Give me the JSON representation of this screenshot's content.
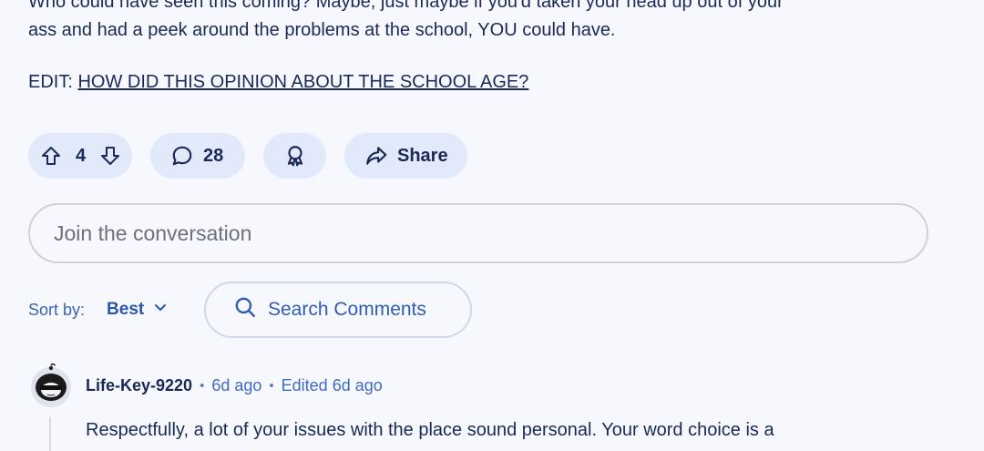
{
  "post": {
    "body_line1": "Who could have seen this coming? Maybe, just maybe if you'd taken your head up out of your",
    "body_line2": "ass and had a peek around the problems at the school, YOU could have.",
    "edit_prefix": "EDIT: ",
    "edit_link": "HOW DID THIS OPINION ABOUT THE SCHOOL AGE?"
  },
  "actions": {
    "vote_count": "4",
    "comment_count": "28",
    "share_label": "Share"
  },
  "join": {
    "placeholder": "Join the conversation"
  },
  "sort": {
    "label": "Sort by:",
    "value": "Best"
  },
  "search": {
    "label": "Search Comments"
  },
  "comment": {
    "author": "Life-Key-9220",
    "time": "6d ago",
    "edited": "Edited 6d ago",
    "text": "Respectfully, a lot of your issues with the place sound personal. Your word choice is a"
  },
  "colors": {
    "background": "#f6f8fe",
    "pill": "#e1e9fb",
    "text": "#1a2a55",
    "accent_blue": "#2f5db2"
  },
  "icons": [
    "upvote-icon",
    "downvote-icon",
    "comment-icon",
    "award-icon",
    "share-icon",
    "search-icon",
    "chevron-down-icon"
  ]
}
